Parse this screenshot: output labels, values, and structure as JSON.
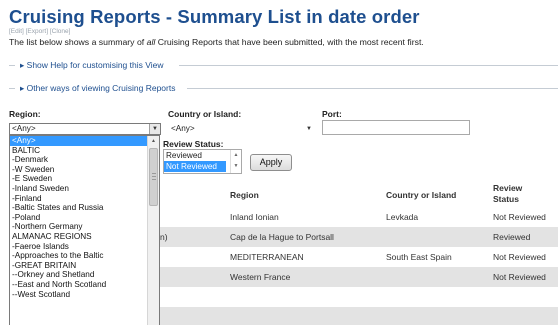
{
  "page": {
    "title": "Cruising Reports - Summary List in date order",
    "edit_links": "[Edit] [Export] [Clone]",
    "intro_text": "The list below shows a summary of all Cruising Reports that have been submitted, with the most recent first."
  },
  "collapsibles": {
    "help_label": "Show Help for customising this View",
    "other_label": "Other ways of viewing Cruising Reports"
  },
  "filters": {
    "region_label": "Region:",
    "region_value": "<Any>",
    "country_label": "Country or Island:",
    "country_value": "<Any>",
    "port_label": "Port:",
    "port_value": "",
    "status_label": "Review Status:",
    "status_options": [
      "Reviewed",
      "Not Reviewed"
    ],
    "status_selected": "Not Reviewed",
    "apply_label": "Apply"
  },
  "region_options": [
    "<Any>",
    "BALTIC",
    "-Denmark",
    "-W Sweden",
    "-E Sweden",
    "-Inland Sweden",
    "-Finland",
    "-Baltic States and Russia",
    "-Poland",
    "-Northern Germany",
    "ALMANAC REGIONS",
    "-Faeroe Islands",
    "-Approaches to the Baltic",
    "-GREAT BRITAIN",
    "--Orkney and Shetland",
    "--East and North Scotland",
    "--West Scotland"
  ],
  "table": {
    "headers": {
      "region": "Region",
      "country": "Country or Island",
      "status": "Review Status"
    },
    "rows": [
      {
        "prefix": "",
        "region": "Inland Ionian",
        "country": "Levkada",
        "status": "Not Reviewed"
      },
      {
        "prefix": "n)",
        "region": "Cap de la Hague to Portsall",
        "country": "",
        "status": "Reviewed"
      },
      {
        "prefix": "",
        "region": "MEDITERRANEAN",
        "country": "South East Spain",
        "status": "Not Reviewed"
      },
      {
        "prefix": "",
        "region": "Western France",
        "country": "",
        "status": "Not Reviewed"
      }
    ]
  },
  "colors": {
    "title": "#1e4f8f",
    "link": "#1e4f8f",
    "selection": "#3399ff",
    "row_shade": "#e3e3e3"
  }
}
